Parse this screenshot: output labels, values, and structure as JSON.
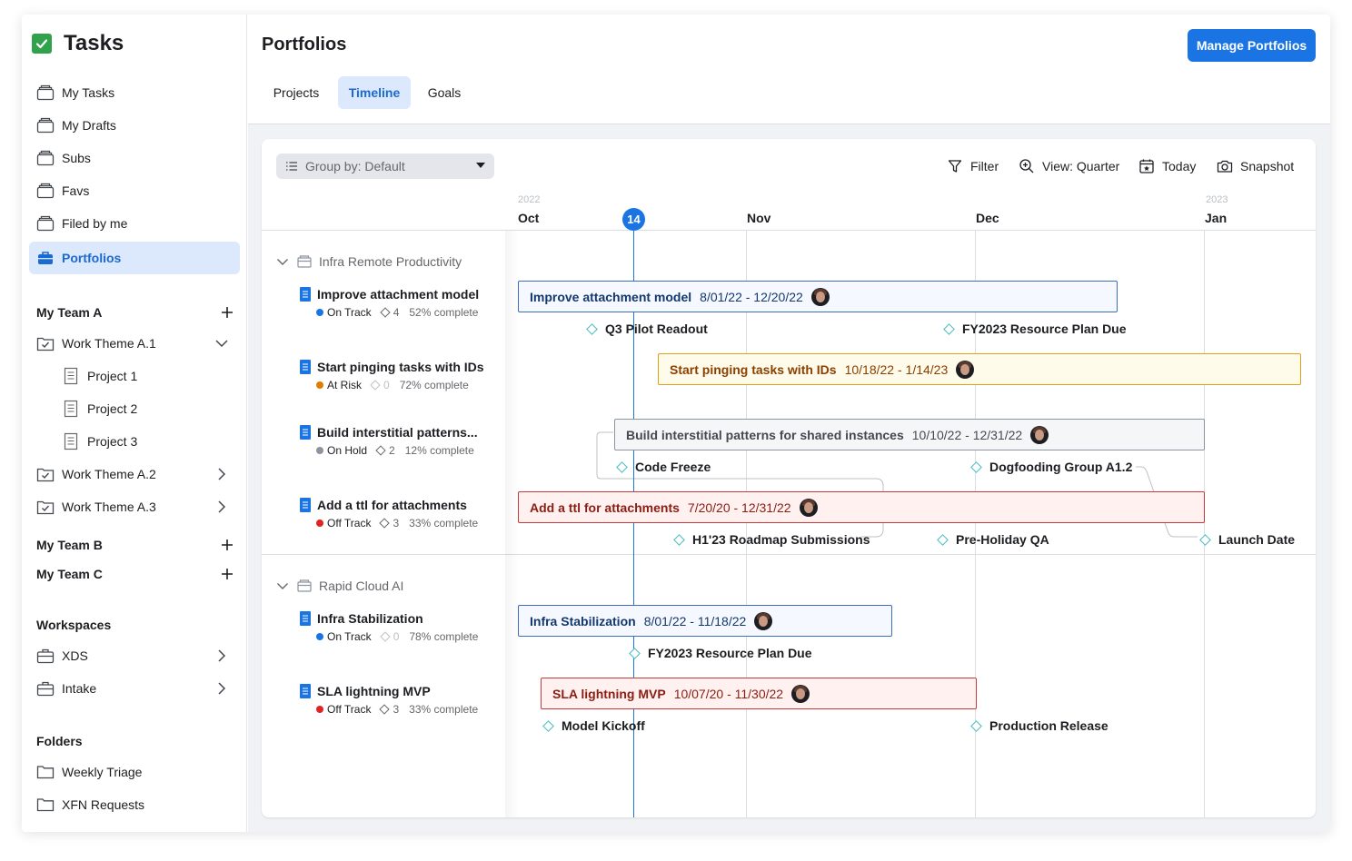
{
  "app": {
    "name": "Tasks"
  },
  "sidebar": {
    "nav": [
      {
        "label": "My Tasks",
        "icon": "stack-icon"
      },
      {
        "label": "My Drafts",
        "icon": "stack-icon"
      },
      {
        "label": "Subs",
        "icon": "stack-icon"
      },
      {
        "label": "Favs",
        "icon": "stack-icon"
      },
      {
        "label": "Filed by me",
        "icon": "stack-icon"
      },
      {
        "label": "Portfolios",
        "icon": "briefcase-icon",
        "active": true
      }
    ],
    "team_a": {
      "label": "My Team A",
      "themes": [
        {
          "label": "Work Theme A.1",
          "expanded": true
        },
        {
          "label": "Work Theme A.2"
        },
        {
          "label": "Work Theme A.3"
        }
      ],
      "projects": [
        "Project 1",
        "Project 2",
        "Project 3"
      ]
    },
    "team_b": {
      "label": "My Team B"
    },
    "team_c": {
      "label": "My Team C"
    },
    "workspaces": {
      "label": "Workspaces",
      "items": [
        "XDS",
        "Intake"
      ]
    },
    "folders": {
      "label": "Folders",
      "items": [
        "Weekly Triage",
        "XFN Requests"
      ]
    }
  },
  "header": {
    "title": "Portfolios",
    "manage_button": "Manage Portfolios",
    "tabs": [
      "Projects",
      "Timeline",
      "Goals"
    ],
    "active_tab": "Timeline"
  },
  "toolbar": {
    "group_by": "Group by: Default",
    "filter": "Filter",
    "view": "View: Quarter",
    "today": "Today",
    "snapshot": "Snapshot"
  },
  "timeline": {
    "years": [
      "2022",
      "2023"
    ],
    "months": [
      "Oct",
      "Nov",
      "Dec",
      "Jan"
    ],
    "today_marker": "14",
    "groups": [
      {
        "name": "Infra Remote Productivity",
        "projects": [
          {
            "title": "Improve attachment model",
            "status": "On Track",
            "status_color": "#1b74e4",
            "count": "4",
            "pct": "52% complete",
            "bar": {
              "name": "Improve attachment model",
              "dates": "8/01/22 - 12/20/22",
              "style": "blue"
            }
          },
          {
            "title": "Start pinging tasks with IDs",
            "status": "At Risk",
            "status_color": "#e07c00",
            "count": "0",
            "pct": "72% complete",
            "bar": {
              "name": "Start pinging tasks with IDs",
              "dates": "10/18/22 - 1/14/23",
              "style": "yellow"
            }
          },
          {
            "title": "Build interstitial patterns...",
            "status": "On Hold",
            "status_color": "#8d949e",
            "count": "2",
            "pct": "12% complete",
            "bar": {
              "name": "Build interstitial patterns for shared instances",
              "dates": "10/10/22 - 12/31/22",
              "style": "gray"
            }
          },
          {
            "title": "Add a ttl for attachments",
            "status": "Off Track",
            "status_color": "#e02424",
            "count": "3",
            "pct": "33% complete",
            "bar": {
              "name": "Add a ttl for attachments",
              "dates": "7/20/20 - 12/31/22",
              "style": "red"
            }
          }
        ],
        "milestones": [
          "Q3 Pilot Readout",
          "FY2023 Resource Plan Due",
          "Code Freeze",
          "Dogfooding Group A1.2",
          "H1'23 Roadmap Submissions",
          "Pre-Holiday QA",
          "Launch Date"
        ]
      },
      {
        "name": "Rapid Cloud AI",
        "projects": [
          {
            "title": "Infra Stabilization",
            "status": "On Track",
            "status_color": "#1b74e4",
            "count": "0",
            "pct": "78% complete",
            "bar": {
              "name": "Infra Stabilization",
              "dates": "8/01/22 - 11/18/22",
              "style": "blue"
            }
          },
          {
            "title": "SLA lightning MVP",
            "status": "Off Track",
            "status_color": "#e02424",
            "count": "3",
            "pct": "33% complete",
            "bar": {
              "name": "SLA lightning MVP",
              "dates": "10/07/20 - 11/30/22",
              "style": "red"
            }
          }
        ],
        "milestones": [
          "FY2023 Resource Plan Due",
          "Model Kickoff",
          "Production Release"
        ]
      }
    ]
  },
  "colors": {
    "accent": "#1b74e4",
    "brand_check": "#31a24c",
    "milestone": "#45bcc5"
  }
}
